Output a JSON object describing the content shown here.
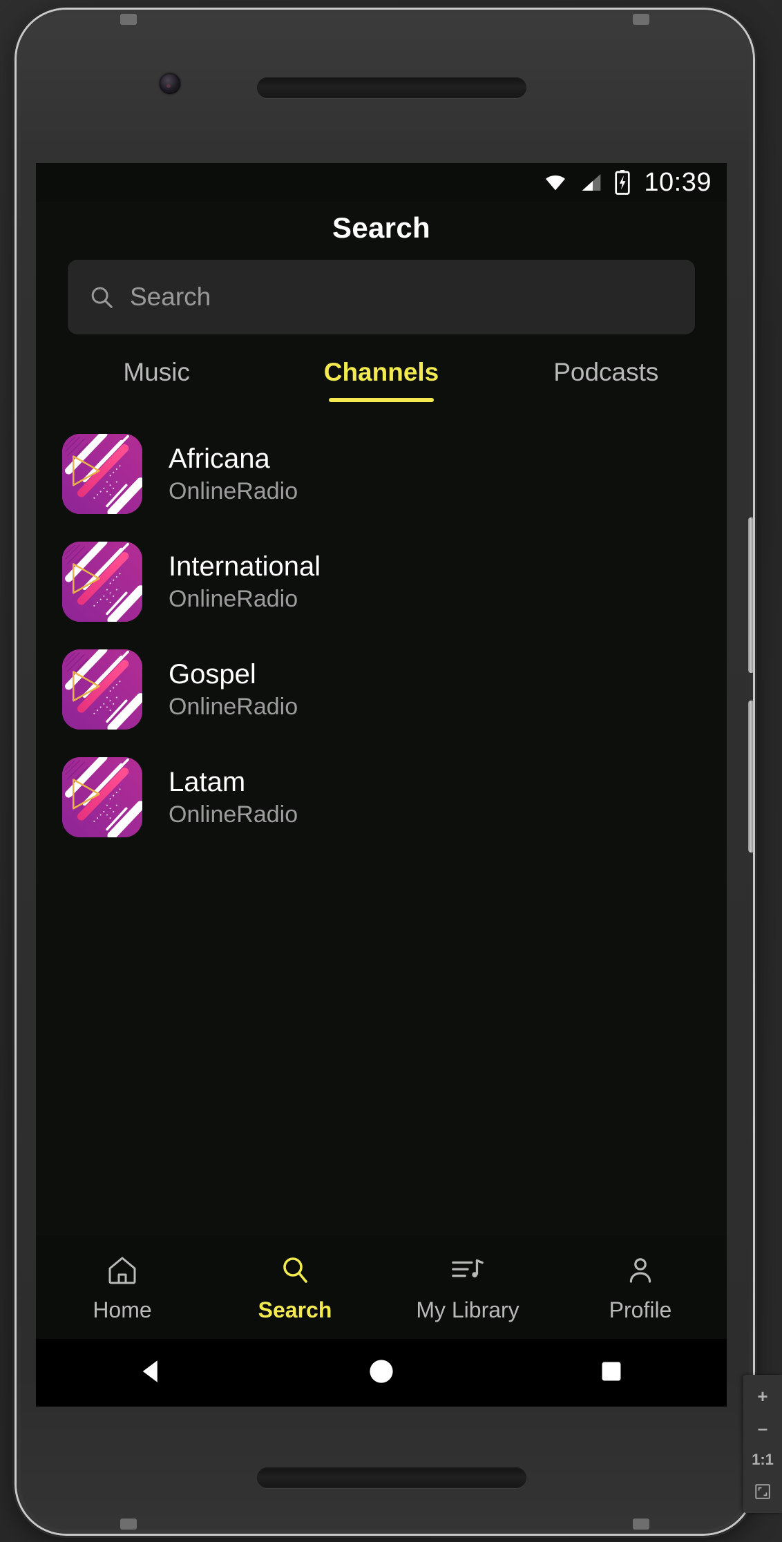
{
  "status_bar": {
    "time": "10:39",
    "icons": [
      "wifi-icon",
      "cellular-signal-icon",
      "battery-charging-icon"
    ]
  },
  "header": {
    "title": "Search"
  },
  "search": {
    "icon": "search-icon",
    "placeholder": "Search",
    "value": ""
  },
  "tabs": {
    "active_index": 1,
    "items": [
      {
        "label": "Music"
      },
      {
        "label": "Channels"
      },
      {
        "label": "Podcasts"
      }
    ]
  },
  "list": {
    "items": [
      {
        "title": "Africana",
        "subtitle": "OnlineRadio",
        "artwork": "radio-channel-artwork"
      },
      {
        "title": "International",
        "subtitle": "OnlineRadio",
        "artwork": "radio-channel-artwork"
      },
      {
        "title": "Gospel",
        "subtitle": "OnlineRadio",
        "artwork": "radio-channel-artwork"
      },
      {
        "title": "Latam",
        "subtitle": "OnlineRadio",
        "artwork": "radio-channel-artwork"
      }
    ]
  },
  "bottom_nav": {
    "active_index": 1,
    "items": [
      {
        "label": "Home",
        "icon": "home-icon"
      },
      {
        "label": "Search",
        "icon": "search-icon"
      },
      {
        "label": "My Library",
        "icon": "playlist-music-icon"
      },
      {
        "label": "Profile",
        "icon": "person-icon"
      }
    ]
  },
  "system_nav": {
    "items": [
      {
        "name": "back-button",
        "icon": "triangle-back-icon"
      },
      {
        "name": "home-button",
        "icon": "circle-home-icon"
      },
      {
        "name": "recents-button",
        "icon": "square-recents-icon"
      }
    ]
  },
  "zoom_panel": {
    "zoom_in": "+",
    "zoom_out": "–",
    "actual_size": "1:1",
    "fit_screen_icon": "fit-to-screen-icon"
  },
  "colors": {
    "accent": "#f2ea50",
    "screen_bg": "#0d0f0d",
    "surface": "#262626",
    "text_primary": "#ffffff",
    "text_secondary": "#9d9d9d",
    "artwork_purple": "#a32a9e",
    "artwork_pink": "#f0307e"
  }
}
